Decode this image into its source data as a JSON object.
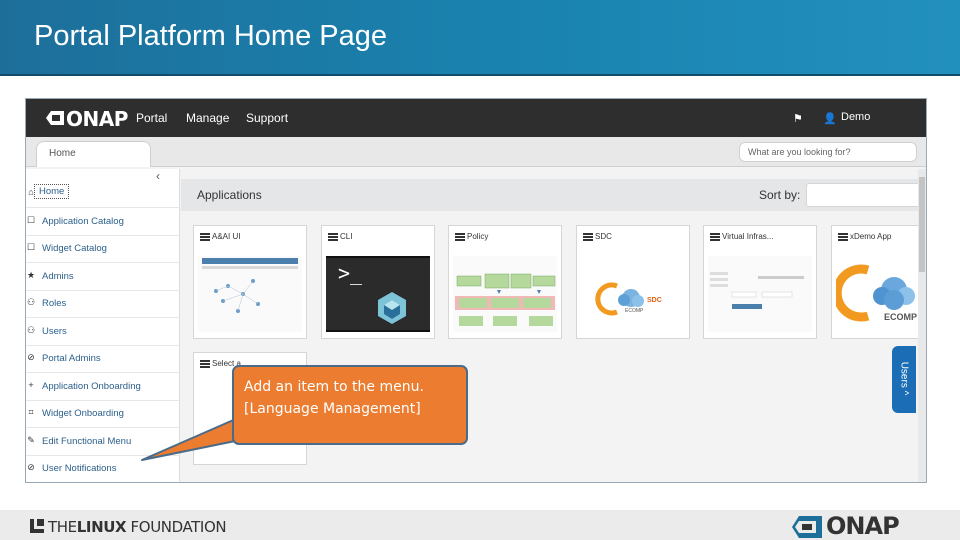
{
  "slide": {
    "title": "Portal Platform Home Page"
  },
  "portal": {
    "brand": "ONAP",
    "nav": [
      "Portal",
      "Manage",
      "Support"
    ],
    "user": "Demo",
    "tab_home": "Home",
    "search_placeholder": "What are you looking for?",
    "collapse_icon": "‹",
    "sidebar": [
      {
        "icon": "⌂",
        "label": "Home"
      },
      {
        "icon": "☐",
        "label": "Application Catalog"
      },
      {
        "icon": "☐",
        "label": "Widget Catalog"
      },
      {
        "icon": "★",
        "label": "Admins"
      },
      {
        "icon": "⚇",
        "label": "Roles"
      },
      {
        "icon": "⚇",
        "label": "Users"
      },
      {
        "icon": "⊘",
        "label": "Portal Admins"
      },
      {
        "icon": "+",
        "label": "Application Onboarding"
      },
      {
        "icon": "⌗",
        "label": "Widget Onboarding"
      },
      {
        "icon": "✎",
        "label": "Edit Functional Menu"
      },
      {
        "icon": "⊘",
        "label": "User Notifications"
      }
    ],
    "applications_title": "Applications",
    "sort_label": "Sort by:",
    "apps": [
      {
        "name": "A&AI UI"
      },
      {
        "name": "CLI"
      },
      {
        "name": "Policy"
      },
      {
        "name": "SDC"
      },
      {
        "name": "Virtual Infras..."
      },
      {
        "name": "xDemo App"
      },
      {
        "name": "Select a..."
      }
    ],
    "users_tab": "Users ^"
  },
  "callout": {
    "line1": "Add an item to the menu.",
    "line2": "[Language Management]"
  },
  "footer": {
    "lf_prefix": "THE",
    "lf_bold": "LINUX",
    "lf_suffix": " FOUNDATION",
    "onap": "ONAP"
  },
  "colors": {
    "header": "#1d6f9a",
    "callout": "#ec7c30",
    "accent": "#1b6eb5"
  }
}
